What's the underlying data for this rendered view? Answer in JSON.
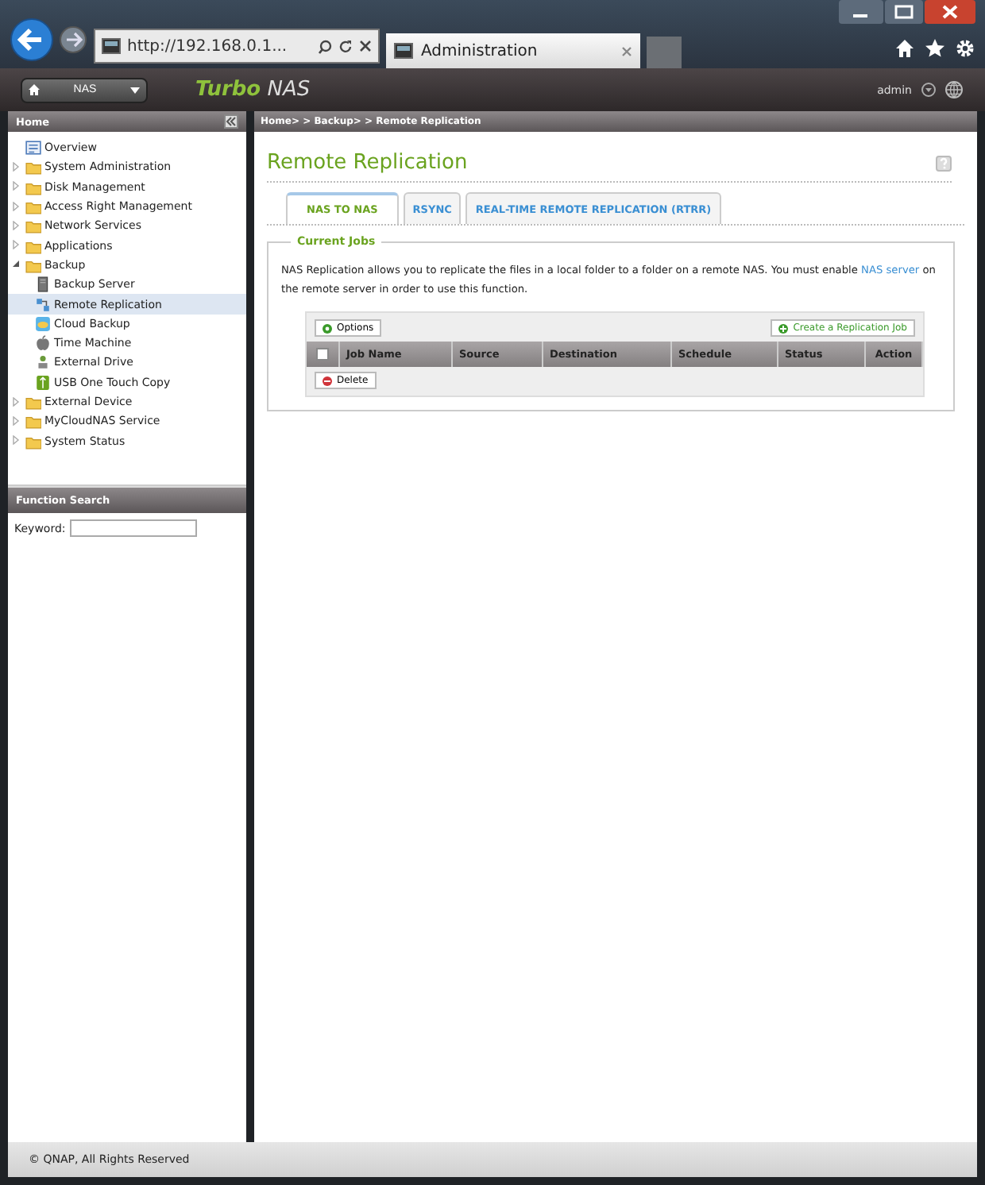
{
  "browser": {
    "address": "http://192.168.0.1...",
    "tab_title": "Administration"
  },
  "app_header": {
    "device_menu": "NAS",
    "brand_first": "Turbo",
    "brand_second": "NAS",
    "user": "admin"
  },
  "sidebar": {
    "title": "Home",
    "items": [
      {
        "label": "Overview",
        "kind": "overview",
        "selected": false
      },
      {
        "label": "System Administration",
        "kind": "folder",
        "expanded": false,
        "selected": false
      },
      {
        "label": "Disk Management",
        "kind": "folder",
        "expanded": false,
        "selected": false
      },
      {
        "label": "Access Right Management",
        "kind": "folder",
        "expanded": false,
        "selected": false
      },
      {
        "label": "Network Services",
        "kind": "folder",
        "expanded": false,
        "selected": false
      },
      {
        "label": "Applications",
        "kind": "folder",
        "expanded": false,
        "selected": false
      },
      {
        "label": "Backup",
        "kind": "folder",
        "expanded": true,
        "selected": false,
        "children": [
          {
            "label": "Backup Server",
            "kind": "server",
            "selected": false
          },
          {
            "label": "Remote Replication",
            "kind": "replication",
            "selected": true
          },
          {
            "label": "Cloud Backup",
            "kind": "cloud",
            "selected": false
          },
          {
            "label": "Time Machine",
            "kind": "apple",
            "selected": false
          },
          {
            "label": "External Drive",
            "kind": "drive",
            "selected": false
          },
          {
            "label": "USB One Touch Copy",
            "kind": "usb",
            "selected": false
          }
        ]
      },
      {
        "label": "External Device",
        "kind": "folder",
        "expanded": false,
        "selected": false
      },
      {
        "label": "MyCloudNAS Service",
        "kind": "folder",
        "expanded": false,
        "selected": false
      },
      {
        "label": "System Status",
        "kind": "folder",
        "expanded": false,
        "selected": false
      }
    ],
    "search": {
      "title": "Function Search",
      "label": "Keyword:"
    }
  },
  "breadcrumb": "Home> > Backup> > Remote Replication",
  "page_title": "Remote Replication",
  "tabs": [
    {
      "label": "NAS TO NAS",
      "selected": true
    },
    {
      "label": "RSYNC",
      "selected": false
    },
    {
      "label": "REAL-TIME REMOTE REPLICATION (RTRR)",
      "selected": false
    }
  ],
  "section": {
    "title": "Current Jobs",
    "description_before": "NAS Replication allows you to replicate the files in a local folder to a folder on a remote NAS. You must enable",
    "description_link": "NAS server",
    "description_after": "on the remote server in order to use this function."
  },
  "toolbar": {
    "options": "Options",
    "create": "Create a Replication Job",
    "delete": "Delete"
  },
  "table": {
    "select_all_checked": false,
    "columns": [
      "Job Name",
      "Source",
      "Destination",
      "Schedule",
      "Status",
      "Action"
    ]
  },
  "footer": "© QNAP, All Rights Reserved"
}
